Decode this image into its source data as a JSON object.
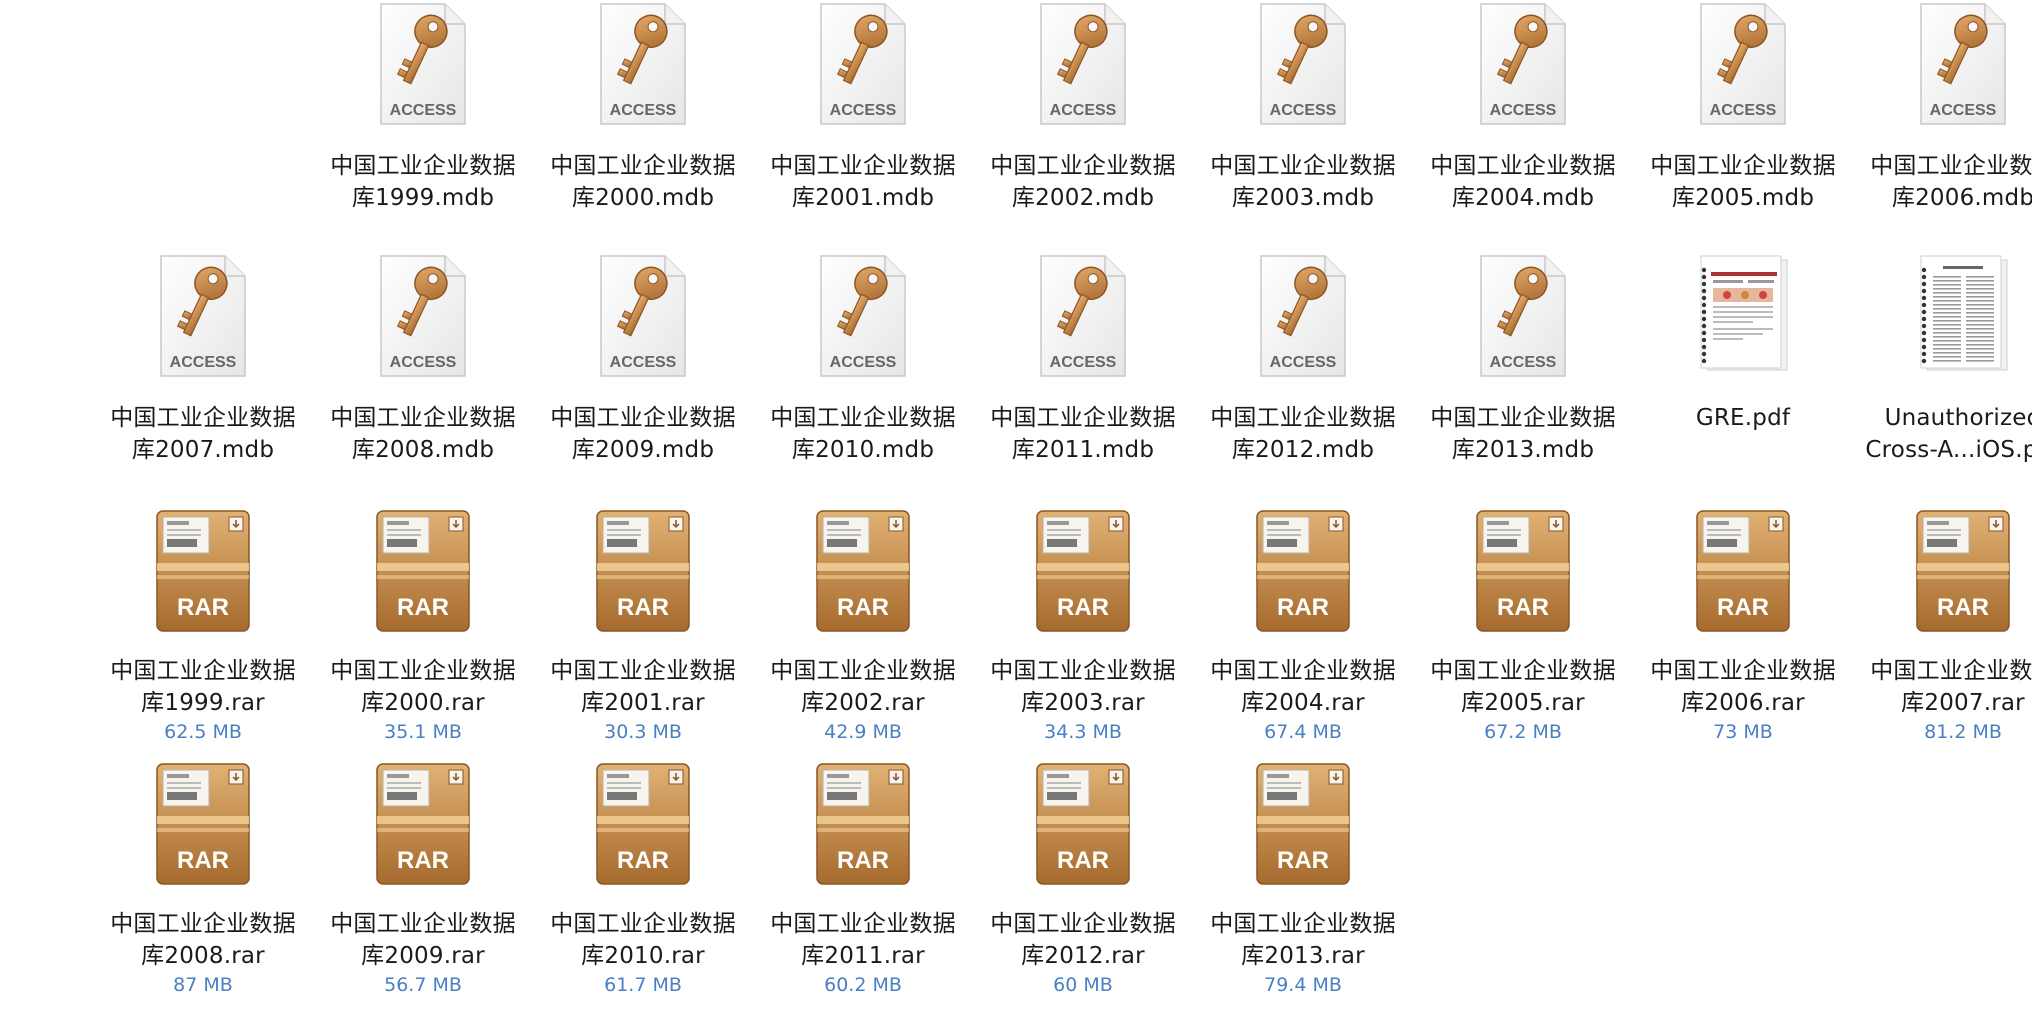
{
  "files": [
    {
      "name_line1": "中国工业企业数据",
      "name_line2": "库1999.mdb",
      "type": "access",
      "icon": "access-key-icon"
    },
    {
      "name_line1": "中国工业企业数据",
      "name_line2": "库2000.mdb",
      "type": "access",
      "icon": "access-key-icon"
    },
    {
      "name_line1": "中国工业企业数据",
      "name_line2": "库2001.mdb",
      "type": "access",
      "icon": "access-key-icon"
    },
    {
      "name_line1": "中国工业企业数据",
      "name_line2": "库2002.mdb",
      "type": "access",
      "icon": "access-key-icon"
    },
    {
      "name_line1": "中国工业企业数据",
      "name_line2": "库2003.mdb",
      "type": "access",
      "icon": "access-key-icon"
    },
    {
      "name_line1": "中国工业企业数据",
      "name_line2": "库2004.mdb",
      "type": "access",
      "icon": "access-key-icon"
    },
    {
      "name_line1": "中国工业企业数据",
      "name_line2": "库2005.mdb",
      "type": "access",
      "icon": "access-key-icon"
    },
    {
      "name_line1": "中国工业企业数据",
      "name_line2": "库2006.mdb",
      "type": "access",
      "icon": "access-key-icon"
    },
    {
      "name_line1": "中国工业企业数据",
      "name_line2": "库2007.mdb",
      "type": "access",
      "icon": "access-key-icon"
    },
    {
      "name_line1": "中国工业企业数据",
      "name_line2": "库2008.mdb",
      "type": "access",
      "icon": "access-key-icon"
    },
    {
      "name_line1": "中国工业企业数据",
      "name_line2": "库2009.mdb",
      "type": "access",
      "icon": "access-key-icon"
    },
    {
      "name_line1": "中国工业企业数据",
      "name_line2": "库2010.mdb",
      "type": "access",
      "icon": "access-key-icon"
    },
    {
      "name_line1": "中国工业企业数据",
      "name_line2": "库2011.mdb",
      "type": "access",
      "icon": "access-key-icon"
    },
    {
      "name_line1": "中国工业企业数据",
      "name_line2": "库2012.mdb",
      "type": "access",
      "icon": "access-key-icon"
    },
    {
      "name_line1": "中国工业企业数据",
      "name_line2": "库2013.mdb",
      "type": "access",
      "icon": "access-key-icon"
    },
    {
      "name_line1": "GRE.pdf",
      "name_line2": "",
      "type": "pdf-color",
      "icon": "pdf-thumbnail-icon"
    },
    {
      "name_line1": "Unauthorized",
      "name_line2": "Cross-A...iOS.pdf",
      "type": "pdf-text",
      "icon": "pdf-thumbnail-icon"
    },
    {
      "name_line1": "中国工业企业数据",
      "name_line2": "库1999.rar",
      "size": "62.5 MB",
      "type": "rar",
      "icon": "rar-archive-icon"
    },
    {
      "name_line1": "中国工业企业数据",
      "name_line2": "库2000.rar",
      "size": "35.1 MB",
      "type": "rar",
      "icon": "rar-archive-icon"
    },
    {
      "name_line1": "中国工业企业数据",
      "name_line2": "库2001.rar",
      "size": "30.3 MB",
      "type": "rar",
      "icon": "rar-archive-icon"
    },
    {
      "name_line1": "中国工业企业数据",
      "name_line2": "库2002.rar",
      "size": "42.9 MB",
      "type": "rar",
      "icon": "rar-archive-icon"
    },
    {
      "name_line1": "中国工业企业数据",
      "name_line2": "库2003.rar",
      "size": "34.3 MB",
      "type": "rar",
      "icon": "rar-archive-icon"
    },
    {
      "name_line1": "中国工业企业数据",
      "name_line2": "库2004.rar",
      "size": "67.4 MB",
      "type": "rar",
      "icon": "rar-archive-icon"
    },
    {
      "name_line1": "中国工业企业数据",
      "name_line2": "库2005.rar",
      "size": "67.2 MB",
      "type": "rar",
      "icon": "rar-archive-icon"
    },
    {
      "name_line1": "中国工业企业数据",
      "name_line2": "库2006.rar",
      "size": "73 MB",
      "type": "rar",
      "icon": "rar-archive-icon"
    },
    {
      "name_line1": "中国工业企业数据",
      "name_line2": "库2007.rar",
      "size": "81.2 MB",
      "type": "rar",
      "icon": "rar-archive-icon"
    },
    {
      "name_line1": "中国工业企业数据",
      "name_line2": "库2008.rar",
      "size": "87 MB",
      "type": "rar",
      "icon": "rar-archive-icon"
    },
    {
      "name_line1": "中国工业企业数据",
      "name_line2": "库2009.rar",
      "size": "56.7 MB",
      "type": "rar",
      "icon": "rar-archive-icon"
    },
    {
      "name_line1": "中国工业企业数据",
      "name_line2": "库2010.rar",
      "size": "61.7 MB",
      "type": "rar",
      "icon": "rar-archive-icon"
    },
    {
      "name_line1": "中国工业企业数据",
      "name_line2": "库2011.rar",
      "size": "60.2 MB",
      "type": "rar",
      "icon": "rar-archive-icon"
    },
    {
      "name_line1": "中国工业企业数据",
      "name_line2": "库2012.rar",
      "size": "60 MB",
      "type": "rar",
      "icon": "rar-archive-icon"
    },
    {
      "name_line1": "中国工业企业数据",
      "name_line2": "库2013.rar",
      "size": "79.4 MB",
      "type": "rar",
      "icon": "rar-archive-icon"
    }
  ],
  "icon_labels": {
    "access": "ACCESS",
    "rar": "RAR"
  },
  "colors": {
    "size_text": "#4a7fc4",
    "name_text": "#1a1a1a",
    "key_gold": "#c8894a",
    "rar_box": "#b57a3c"
  }
}
